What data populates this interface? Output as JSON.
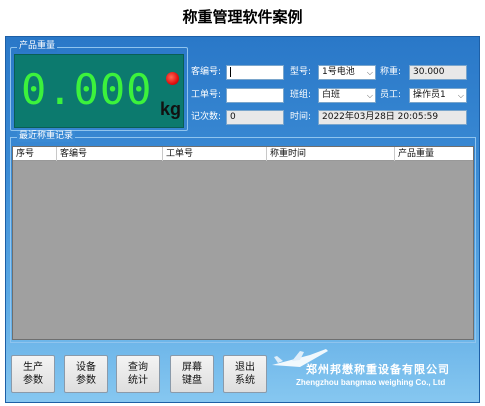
{
  "doc_title": "称重管理软件案例",
  "weight": {
    "group_label": "产品重量",
    "value": "0.000",
    "unit": "kg"
  },
  "form": {
    "customer_no": {
      "label": "客编号:",
      "value": ""
    },
    "model": {
      "label": "型号:",
      "value": "1号电池"
    },
    "weighing": {
      "label": "称重:",
      "value": "30.000"
    },
    "work_order": {
      "label": "工单号:",
      "value": ""
    },
    "shift": {
      "label": "班组:",
      "value": "白班"
    },
    "employee": {
      "label": "员工:",
      "value": "操作员1"
    },
    "record_count": {
      "label": "记次数:",
      "value": "0"
    },
    "time": {
      "label": "时间:",
      "value": "2022年03月28日  20:05:59"
    }
  },
  "records": {
    "group_label": "最近称重记录",
    "columns": [
      "序号",
      "客编号",
      "工单号",
      "称重时间",
      "产品重量"
    ],
    "rows": []
  },
  "buttons": [
    {
      "line1": "生产",
      "line2": "参数"
    },
    {
      "line1": "设备",
      "line2": "参数"
    },
    {
      "line1": "查询",
      "line2": "统计"
    },
    {
      "line1": "屏幕",
      "line2": "键盘"
    },
    {
      "line1": "退出",
      "line2": "系统"
    }
  ],
  "company": {
    "name_cn": "郑州邦懋称重设备有限公司",
    "name_en": "Zhengzhou bangmao weighing Co., Ltd"
  },
  "colors": {
    "panel_gradient_top": "#2a78c8",
    "display_bg": "#0c7a6e",
    "display_digits": "#3cf23c",
    "indicator": "#e01010"
  },
  "icons": {
    "indicator": "red-status-dot",
    "select_arrow": "chevron-down-icon",
    "logo": "airplane-logo"
  }
}
